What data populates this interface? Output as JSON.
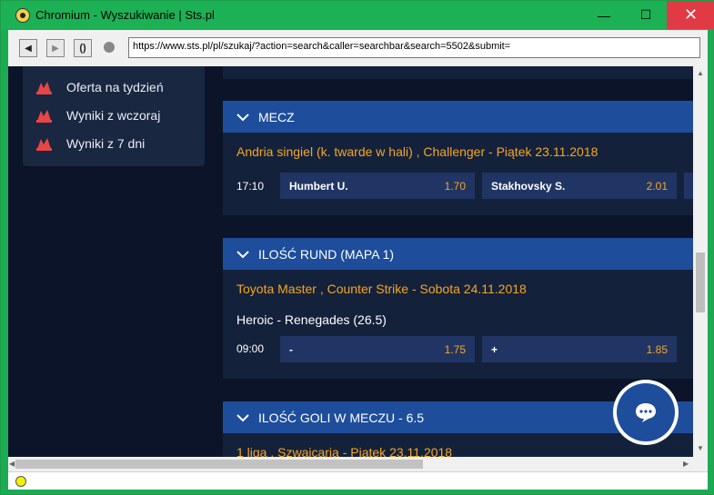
{
  "window": {
    "title": "Chromium - Wyszukiwanie | Sts.pl",
    "minimize": "—",
    "maximize": "☐",
    "close": "✕"
  },
  "toolbar": {
    "url": "https://www.sts.pl/pl/szukaj/?action=search&caller=searchbar&search=5502&submit="
  },
  "sidebar": {
    "items": [
      {
        "label": "Oferta na tydzień",
        "icon": "pdf-icon"
      },
      {
        "label": "Wyniki z wczoraj",
        "icon": "pdf-icon"
      },
      {
        "label": "Wyniki z 7 dni",
        "icon": "pdf-icon"
      }
    ]
  },
  "sections": [
    {
      "header": "MECZ",
      "league": "Andria singiel (k. twarde w hali) , Challenger   - Piątek 23.11.2018",
      "time": "17:10",
      "odds": [
        {
          "name": "Humbert U.",
          "value": "1.70"
        },
        {
          "name": "Stakhovsky S.",
          "value": "2.01"
        }
      ]
    },
    {
      "header": "ILOŚĆ RUND (MAPA 1)",
      "league": "Toyota Master , Counter Strike   - Sobota 24.11.2018",
      "match": "Heroic - Renegades (26.5)",
      "time": "09:00",
      "odds": [
        {
          "name": "-",
          "value": "1.75"
        },
        {
          "name": "+",
          "value": "1.85"
        }
      ]
    },
    {
      "header": "ILOŚĆ GOLI W MECZU - 6.5",
      "league": "1 liga , Szwajcaria   - Piątek 23.11.2018"
    }
  ],
  "colors": {
    "accent": "#f5a623",
    "header_blue": "#1e4d9c",
    "page_bg": "#0b1428",
    "window_frame": "#1cab52"
  }
}
